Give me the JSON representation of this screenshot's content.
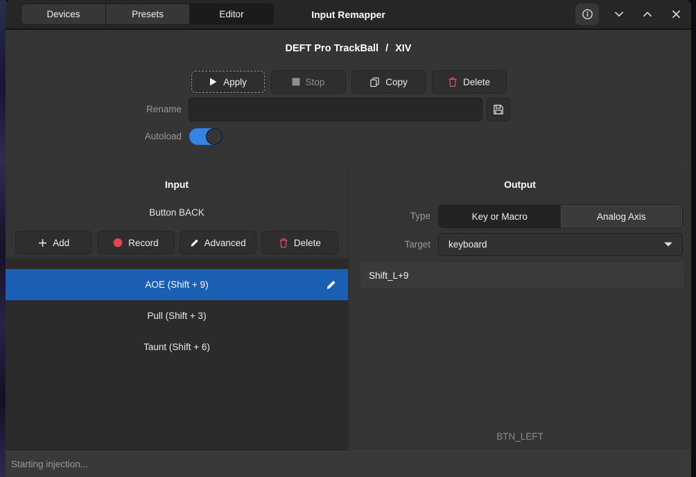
{
  "titlebar": {
    "title": "Input Remapper",
    "tabs": [
      {
        "label": "Devices",
        "active": false
      },
      {
        "label": "Presets",
        "active": false
      },
      {
        "label": "Editor",
        "active": true
      }
    ]
  },
  "profile": {
    "device": "DEFT Pro TrackBall",
    "separator": "/",
    "preset": "XIV",
    "actions": {
      "apply": "Apply",
      "stop": "Stop",
      "copy": "Copy",
      "delete": "Delete"
    },
    "stop_disabled": true,
    "rename_label": "Rename",
    "rename_value": "",
    "autoload_label": "Autoload",
    "autoload_state": "on"
  },
  "input_panel": {
    "title": "Input",
    "selected_input": "Button BACK",
    "actions": {
      "add": "Add",
      "record": "Record",
      "advanced": "Advanced",
      "delete": "Delete"
    },
    "mappings": [
      {
        "label": "AOE (Shift + 9)",
        "selected": true
      },
      {
        "label": "Pull (Shift + 3)",
        "selected": false
      },
      {
        "label": "Taunt (Shift + 6)",
        "selected": false
      }
    ]
  },
  "output_panel": {
    "title": "Output",
    "type_label": "Type",
    "type_options": [
      {
        "label": "Key or Macro",
        "selected": true
      },
      {
        "label": "Analog Axis",
        "selected": false
      }
    ],
    "target_label": "Target",
    "target_value": "keyboard",
    "output_code": "Shift_L+9",
    "recorded_input": "BTN_LEFT"
  },
  "statusbar": {
    "message": "Starting injection..."
  },
  "icons": {
    "info-icon": "circled i",
    "chevron-down-icon": "v chevron",
    "chevron-up-icon": "^ chevron",
    "close-icon": "x cross",
    "play-icon": "filled triangle",
    "stop-icon": "gray square",
    "copy-icon": "two pages",
    "trash-icon": "red trash can",
    "save-icon": "floppy disk",
    "plus-icon": "plus sign",
    "record-icon": "red dot",
    "pencil-icon": "pencil",
    "dropdown-caret-icon": "filled down triangle"
  },
  "colors": {
    "selection_blue": "#1a5fb4",
    "toggle_blue": "#3584e4",
    "record_red": "#e8434f",
    "destructive_red": "#ee4d5a",
    "window_bg": "#353535",
    "headerbar_bg": "#262626",
    "list_bg": "#2b2b2b"
  }
}
